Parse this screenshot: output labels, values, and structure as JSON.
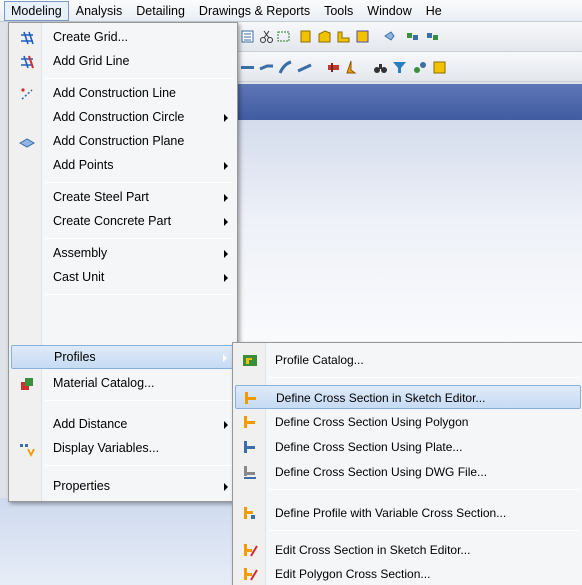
{
  "menubar": {
    "items": [
      "Modeling",
      "Analysis",
      "Detailing",
      "Drawings & Reports",
      "Tools",
      "Window",
      "He"
    ],
    "active_index": 0
  },
  "modeling_menu": {
    "items": [
      {
        "label": "Create Grid...",
        "icon": "grid-icon",
        "submenu": false
      },
      {
        "label": "Add Grid Line",
        "icon": "grid-line-icon",
        "submenu": false
      },
      {
        "label": "Add Construction Line",
        "icon": "construction-line-icon",
        "submenu": false
      },
      {
        "label": "Add Construction Circle",
        "icon": "",
        "submenu": true
      },
      {
        "label": "Add Construction Plane",
        "icon": "construction-plane-icon",
        "submenu": false
      },
      {
        "label": "Add Points",
        "icon": "",
        "submenu": true
      },
      {
        "label": "Create Steel Part",
        "icon": "",
        "submenu": true
      },
      {
        "label": "Create Concrete Part",
        "icon": "",
        "submenu": true
      },
      {
        "label": "Assembly",
        "icon": "",
        "submenu": true
      },
      {
        "label": "Cast Unit",
        "icon": "",
        "submenu": true
      },
      {
        "label": "Profiles",
        "icon": "",
        "submenu": true,
        "highlighted": true
      },
      {
        "label": "Material Catalog...",
        "icon": "material-catalog-icon",
        "submenu": false
      },
      {
        "label": "Add Distance",
        "icon": "",
        "submenu": true
      },
      {
        "label": "Display Variables...",
        "icon": "display-variables-icon",
        "submenu": false
      },
      {
        "label": "Properties",
        "icon": "",
        "submenu": true
      }
    ]
  },
  "profiles_submenu": {
    "items": [
      {
        "label": "Profile Catalog...",
        "icon": "profile-catalog-icon"
      },
      {
        "label": "Define Cross Section in Sketch Editor...",
        "icon": "sketch-editor-icon",
        "highlighted": true
      },
      {
        "label": "Define Cross Section Using Polygon",
        "icon": "polygon-section-icon"
      },
      {
        "label": "Define Cross Section Using Plate...",
        "icon": "plate-section-icon"
      },
      {
        "label": "Define Cross Section Using DWG File...",
        "icon": "dwg-section-icon"
      },
      {
        "label": "Define Profile with Variable Cross Section...",
        "icon": "variable-section-icon"
      },
      {
        "label": "Edit Cross Section in Sketch Editor...",
        "icon": "edit-sketch-icon"
      },
      {
        "label": "Edit Polygon Cross Section...",
        "icon": "edit-polygon-icon"
      }
    ]
  },
  "colors": {
    "highlight_border": "#89b1dd",
    "viewport_header": "#4a64a8",
    "toolbar_yellow": "#f2c200"
  }
}
